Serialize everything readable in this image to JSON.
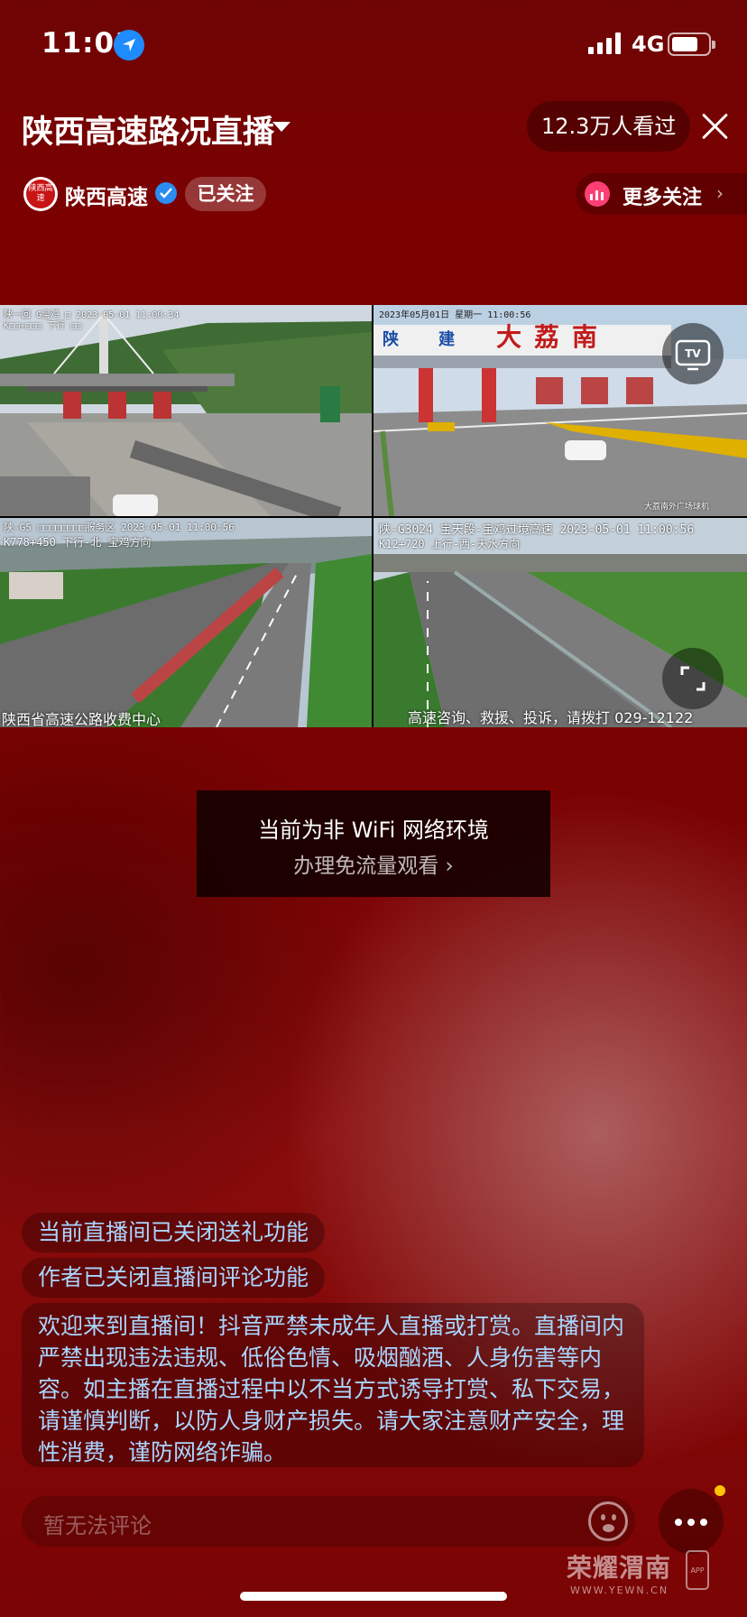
{
  "status_bar": {
    "time": "11:01",
    "network": "4G"
  },
  "header": {
    "title": "陕西高速路况直播",
    "viewers": "12.3万人看过"
  },
  "anchor": {
    "avatar_text": "陕西高速",
    "name": "陕西高速",
    "follow_state": "已关注",
    "more_follow": "更多关注"
  },
  "video": {
    "cams": [
      {
        "osd_top": "陕一回 G宝鸡 □ 2023-05-01 11:00:34",
        "osd_sub": "K□□+□□□ 下行 □□",
        "footer": ""
      },
      {
        "osd_top": "2023年05月01日 星期一 11:00:56",
        "sign_left": "陕",
        "sign_mid": "建",
        "sign_right": "大荔南",
        "footer": "大荔南外广场球机"
      },
      {
        "osd_top": "陕-G5 □□□□□□□□服务区 2023-05-01 11:00:56",
        "osd_sub": "K778+450 下行-北 宝鸡方向",
        "footer": "陕西省高速公路收费中心"
      },
      {
        "osd_top": "陕-G3024 宝天段-宝鸡过境高速 2023-05-01 11:00:56",
        "osd_sub": "K12+720 上行-西-天水方向",
        "footer": "高速咨询、救援、投诉，请拨打 029-12122"
      }
    ]
  },
  "wifi_notice": {
    "line1": "当前为非 WiFi 网络环境",
    "line2": "办理免流量观看 ›"
  },
  "chat": {
    "msg1": "当前直播间已关闭送礼功能",
    "msg2": "作者已关闭直播间评论功能",
    "welcome": "欢迎来到直播间！抖音严禁未成年人直播或打赏。直播间内严禁出现违法违规、低俗色情、吸烟酗酒、人身伤害等内容。如主播在直播过程中以不当方式诱导打赏、私下交易，请谨慎判断，以防人身财产损失。请大家注意财产安全，理性消费，谨防网络诈骗。"
  },
  "bottom": {
    "comment_placeholder": "暂无法评论"
  },
  "watermark": {
    "title": "荣耀渭南",
    "sub": "WWW.YEWN.CN",
    "app": "APP"
  }
}
